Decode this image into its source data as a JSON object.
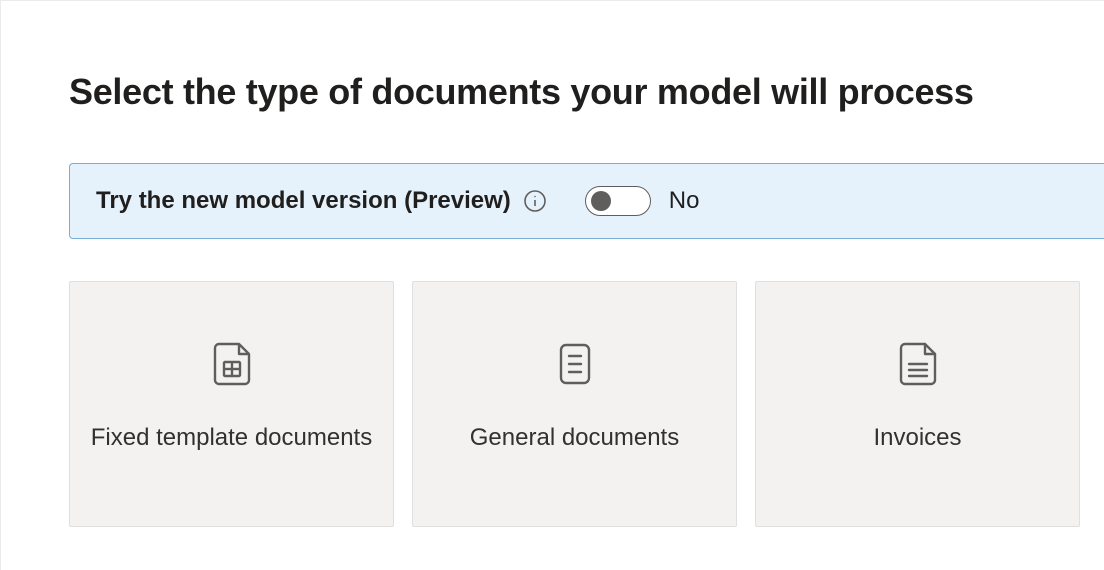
{
  "title": "Select the type of documents your model will process",
  "banner": {
    "text": "Try the new model version (Preview)",
    "toggle_state": "No"
  },
  "cards": {
    "fixed_template": {
      "label": "Fixed template documents"
    },
    "general": {
      "label": "General documents"
    },
    "invoices": {
      "label": "Invoices"
    }
  }
}
